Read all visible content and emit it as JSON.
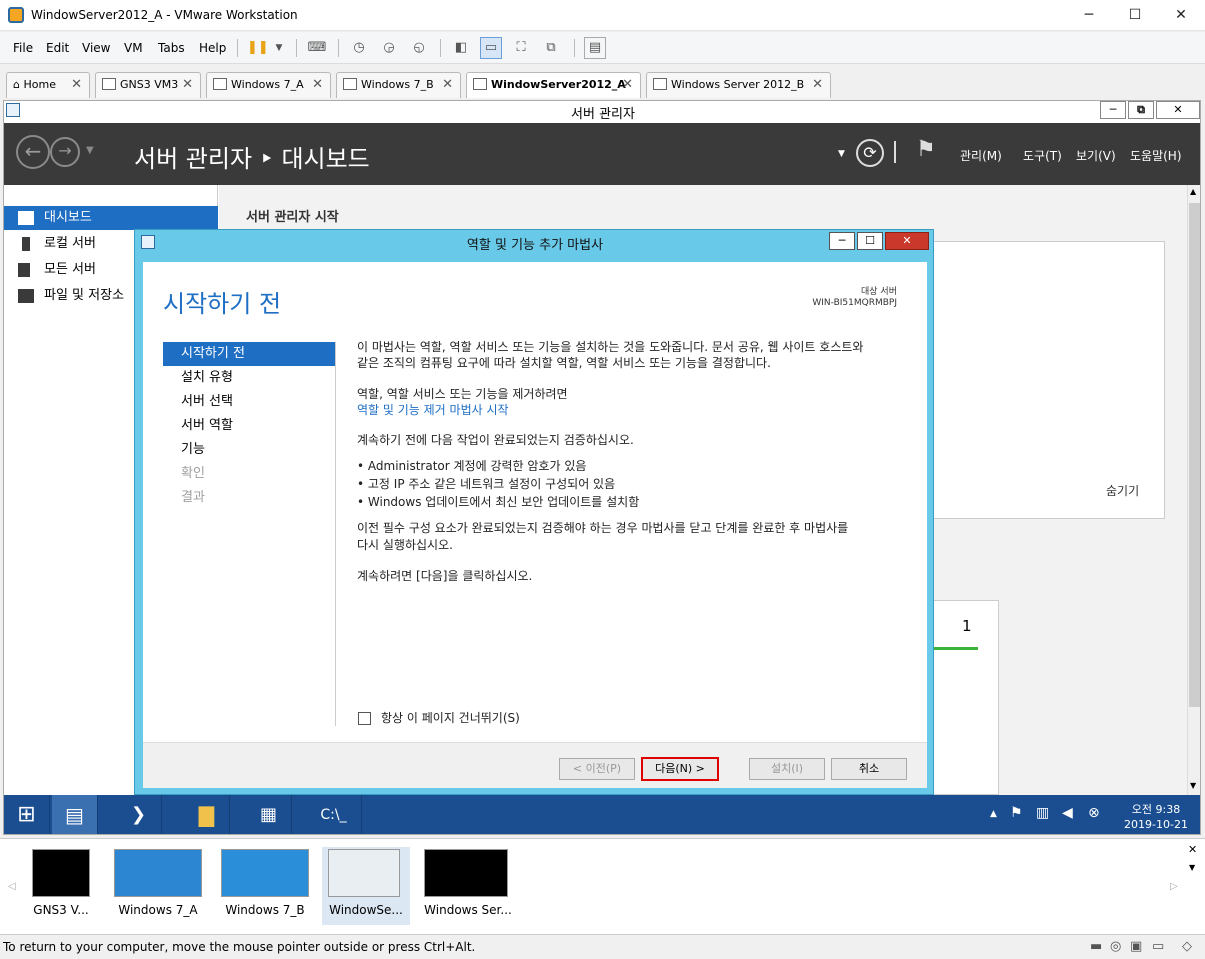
{
  "window": {
    "title": "WindowServer2012_A - VMware Workstation",
    "min_icon": "─",
    "max_icon": "☐",
    "close_icon": "✕"
  },
  "menu": [
    {
      "label": "File"
    },
    {
      "label": "Edit"
    },
    {
      "label": "View"
    },
    {
      "label": "VM"
    },
    {
      "label": "Tabs"
    },
    {
      "label": "Help"
    }
  ],
  "tabs": [
    {
      "label": "Home"
    },
    {
      "label": "GNS3 VM3"
    },
    {
      "label": "Windows 7_A"
    },
    {
      "label": "Windows 7_B"
    },
    {
      "label": "WindowServer2012_A",
      "active": true
    },
    {
      "label": "Windows Server 2012_B"
    }
  ],
  "server_manager": {
    "title": "서버 관리자",
    "breadcrumb": "서버 관리자 ‣ 대시보드",
    "menus": [
      {
        "label": "관리(M)"
      },
      {
        "label": "도구(T)"
      },
      {
        "label": "보기(V)"
      },
      {
        "label": "도움말(H)"
      }
    ],
    "nav": [
      {
        "label": "대시보드"
      },
      {
        "label": "로컬 서버"
      },
      {
        "label": "모든 서버"
      },
      {
        "label": "파일 및 저장소"
      }
    ],
    "section_title": "서버 관리자 시작",
    "hide_label": "숨기기",
    "tile_count": "1"
  },
  "wizard": {
    "title": "역할 및 기능 추가 마법사",
    "heading": "시작하기 전",
    "target_label": "대상 서버",
    "target_server": "WIN-BI51MQRMBPJ",
    "steps": [
      {
        "label": "시작하기 전",
        "state": "selected"
      },
      {
        "label": "설치 유형",
        "state": "normal"
      },
      {
        "label": "서버 선택",
        "state": "normal"
      },
      {
        "label": "서버 역할",
        "state": "normal"
      },
      {
        "label": "기능",
        "state": "normal"
      },
      {
        "label": "확인",
        "state": "disabled"
      },
      {
        "label": "결과",
        "state": "disabled"
      }
    ],
    "intro_1": "이 마법사는 역할, 역할 서비스 또는 기능을 설치하는 것을 도와줍니다. 문서 공유, 웹 사이트 호스트와",
    "intro_2": "같은 조직의 컴퓨팅 요구에 따라 설치할 역할, 역할 서비스 또는 기능을 결정합니다.",
    "remove_text": "역할, 역할 서비스 또는 기능을 제거하려면",
    "remove_link": "역할 및 기능 제거 마법사 시작",
    "verify_text": "계속하기 전에 다음 작업이 완료되었는지 검증하십시오.",
    "bullets": [
      "• Administrator 계정에 강력한 암호가 있음",
      "• 고정 IP 주소 같은 네트워크 설정이 구성되어 있음",
      "• Windows 업데이트에서 최신 보안 업데이트를 설치함"
    ],
    "prereq_1": "이전 필수 구성 요소가 완료되었는지 검증해야 하는 경우 마법사를 닫고 단계를 완료한 후 마법사를",
    "prereq_2": "다시 실행하십시오.",
    "continue_text": "계속하려면 [다음]을 클릭하십시오.",
    "skip_label": "항상 이 페이지 건너뛰기(S)",
    "btn_prev": "< 이전(P)",
    "btn_next": "다음(N) >",
    "btn_install": "설치(I)",
    "btn_cancel": "취소"
  },
  "clock": {
    "time": "오전 9:38",
    "date": "2019-10-21"
  },
  "thumbnails": [
    {
      "label": "GNS3 V..."
    },
    {
      "label": "Windows 7_A"
    },
    {
      "label": "Windows 7_B"
    },
    {
      "label": "WindowSe..."
    },
    {
      "label": "Windows Ser..."
    }
  ],
  "status_text": "To return to your computer, move the mouse pointer outside or press Ctrl+Alt.",
  "colors": {
    "accent": "#1e6ec4",
    "wizard_frame": "#69c9e8",
    "next_highlight": "#e00000",
    "taskbar": "#1a4e91"
  }
}
